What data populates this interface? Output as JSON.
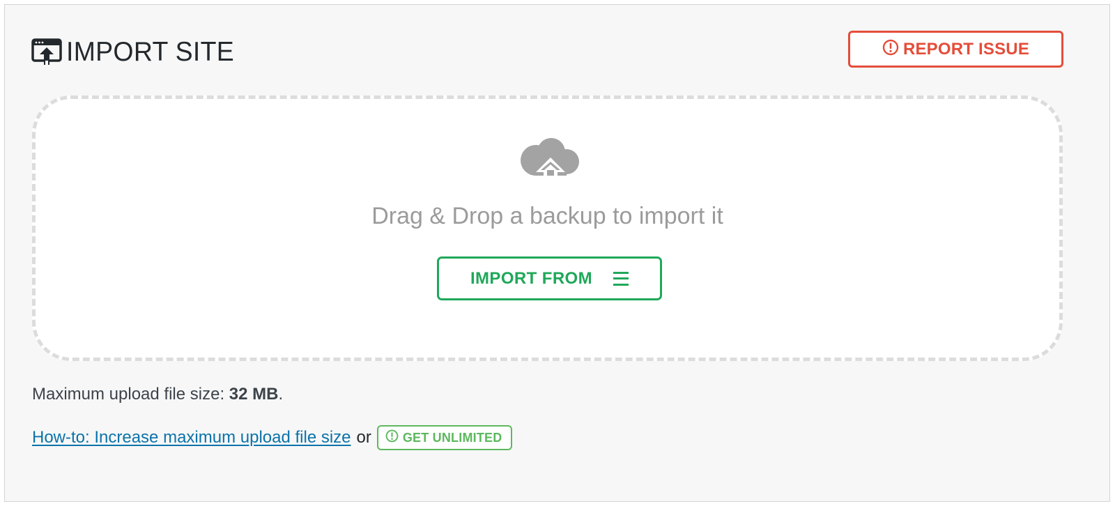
{
  "header": {
    "title": "IMPORT SITE",
    "title_icon": "import-window-icon",
    "report_button_label": "REPORT ISSUE",
    "report_icon": "exclamation-circle-icon"
  },
  "dropzone": {
    "icon": "cloud-upload-icon",
    "prompt": "Drag & Drop a backup to import it",
    "import_button_label": "IMPORT FROM",
    "import_button_icon": "menu-icon"
  },
  "footer": {
    "max_upload_prefix": "Maximum upload file size: ",
    "max_upload_value": "32 MB",
    "max_upload_suffix": ".",
    "howto_link": "How-to: Increase maximum upload file size",
    "or_text": "or",
    "unlimited_button_label": "GET UNLIMITED",
    "unlimited_icon": "exclamation-circle-icon"
  },
  "colors": {
    "report": "#e44d3a",
    "import": "#1fa85a",
    "unlimited": "#5cb85c",
    "link": "#0a73aa",
    "muted": "#9b9b9b"
  }
}
